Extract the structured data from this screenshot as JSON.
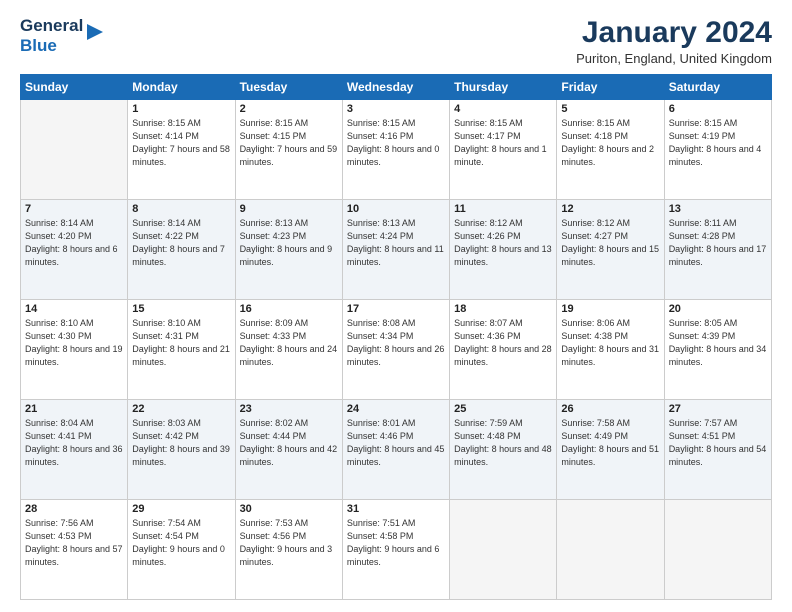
{
  "header": {
    "logo_line1": "General",
    "logo_line2": "Blue",
    "month_title": "January 2024",
    "location": "Puriton, England, United Kingdom"
  },
  "days_of_week": [
    "Sunday",
    "Monday",
    "Tuesday",
    "Wednesday",
    "Thursday",
    "Friday",
    "Saturday"
  ],
  "weeks": [
    [
      {
        "day": "",
        "empty": true
      },
      {
        "day": "1",
        "sunrise": "Sunrise: 8:15 AM",
        "sunset": "Sunset: 4:14 PM",
        "daylight": "Daylight: 7 hours and 58 minutes."
      },
      {
        "day": "2",
        "sunrise": "Sunrise: 8:15 AM",
        "sunset": "Sunset: 4:15 PM",
        "daylight": "Daylight: 7 hours and 59 minutes."
      },
      {
        "day": "3",
        "sunrise": "Sunrise: 8:15 AM",
        "sunset": "Sunset: 4:16 PM",
        "daylight": "Daylight: 8 hours and 0 minutes."
      },
      {
        "day": "4",
        "sunrise": "Sunrise: 8:15 AM",
        "sunset": "Sunset: 4:17 PM",
        "daylight": "Daylight: 8 hours and 1 minute."
      },
      {
        "day": "5",
        "sunrise": "Sunrise: 8:15 AM",
        "sunset": "Sunset: 4:18 PM",
        "daylight": "Daylight: 8 hours and 2 minutes."
      },
      {
        "day": "6",
        "sunrise": "Sunrise: 8:15 AM",
        "sunset": "Sunset: 4:19 PM",
        "daylight": "Daylight: 8 hours and 4 minutes."
      }
    ],
    [
      {
        "day": "7",
        "sunrise": "Sunrise: 8:14 AM",
        "sunset": "Sunset: 4:20 PM",
        "daylight": "Daylight: 8 hours and 6 minutes."
      },
      {
        "day": "8",
        "sunrise": "Sunrise: 8:14 AM",
        "sunset": "Sunset: 4:22 PM",
        "daylight": "Daylight: 8 hours and 7 minutes."
      },
      {
        "day": "9",
        "sunrise": "Sunrise: 8:13 AM",
        "sunset": "Sunset: 4:23 PM",
        "daylight": "Daylight: 8 hours and 9 minutes."
      },
      {
        "day": "10",
        "sunrise": "Sunrise: 8:13 AM",
        "sunset": "Sunset: 4:24 PM",
        "daylight": "Daylight: 8 hours and 11 minutes."
      },
      {
        "day": "11",
        "sunrise": "Sunrise: 8:12 AM",
        "sunset": "Sunset: 4:26 PM",
        "daylight": "Daylight: 8 hours and 13 minutes."
      },
      {
        "day": "12",
        "sunrise": "Sunrise: 8:12 AM",
        "sunset": "Sunset: 4:27 PM",
        "daylight": "Daylight: 8 hours and 15 minutes."
      },
      {
        "day": "13",
        "sunrise": "Sunrise: 8:11 AM",
        "sunset": "Sunset: 4:28 PM",
        "daylight": "Daylight: 8 hours and 17 minutes."
      }
    ],
    [
      {
        "day": "14",
        "sunrise": "Sunrise: 8:10 AM",
        "sunset": "Sunset: 4:30 PM",
        "daylight": "Daylight: 8 hours and 19 minutes."
      },
      {
        "day": "15",
        "sunrise": "Sunrise: 8:10 AM",
        "sunset": "Sunset: 4:31 PM",
        "daylight": "Daylight: 8 hours and 21 minutes."
      },
      {
        "day": "16",
        "sunrise": "Sunrise: 8:09 AM",
        "sunset": "Sunset: 4:33 PM",
        "daylight": "Daylight: 8 hours and 24 minutes."
      },
      {
        "day": "17",
        "sunrise": "Sunrise: 8:08 AM",
        "sunset": "Sunset: 4:34 PM",
        "daylight": "Daylight: 8 hours and 26 minutes."
      },
      {
        "day": "18",
        "sunrise": "Sunrise: 8:07 AM",
        "sunset": "Sunset: 4:36 PM",
        "daylight": "Daylight: 8 hours and 28 minutes."
      },
      {
        "day": "19",
        "sunrise": "Sunrise: 8:06 AM",
        "sunset": "Sunset: 4:38 PM",
        "daylight": "Daylight: 8 hours and 31 minutes."
      },
      {
        "day": "20",
        "sunrise": "Sunrise: 8:05 AM",
        "sunset": "Sunset: 4:39 PM",
        "daylight": "Daylight: 8 hours and 34 minutes."
      }
    ],
    [
      {
        "day": "21",
        "sunrise": "Sunrise: 8:04 AM",
        "sunset": "Sunset: 4:41 PM",
        "daylight": "Daylight: 8 hours and 36 minutes."
      },
      {
        "day": "22",
        "sunrise": "Sunrise: 8:03 AM",
        "sunset": "Sunset: 4:42 PM",
        "daylight": "Daylight: 8 hours and 39 minutes."
      },
      {
        "day": "23",
        "sunrise": "Sunrise: 8:02 AM",
        "sunset": "Sunset: 4:44 PM",
        "daylight": "Daylight: 8 hours and 42 minutes."
      },
      {
        "day": "24",
        "sunrise": "Sunrise: 8:01 AM",
        "sunset": "Sunset: 4:46 PM",
        "daylight": "Daylight: 8 hours and 45 minutes."
      },
      {
        "day": "25",
        "sunrise": "Sunrise: 7:59 AM",
        "sunset": "Sunset: 4:48 PM",
        "daylight": "Daylight: 8 hours and 48 minutes."
      },
      {
        "day": "26",
        "sunrise": "Sunrise: 7:58 AM",
        "sunset": "Sunset: 4:49 PM",
        "daylight": "Daylight: 8 hours and 51 minutes."
      },
      {
        "day": "27",
        "sunrise": "Sunrise: 7:57 AM",
        "sunset": "Sunset: 4:51 PM",
        "daylight": "Daylight: 8 hours and 54 minutes."
      }
    ],
    [
      {
        "day": "28",
        "sunrise": "Sunrise: 7:56 AM",
        "sunset": "Sunset: 4:53 PM",
        "daylight": "Daylight: 8 hours and 57 minutes."
      },
      {
        "day": "29",
        "sunrise": "Sunrise: 7:54 AM",
        "sunset": "Sunset: 4:54 PM",
        "daylight": "Daylight: 9 hours and 0 minutes."
      },
      {
        "day": "30",
        "sunrise": "Sunrise: 7:53 AM",
        "sunset": "Sunset: 4:56 PM",
        "daylight": "Daylight: 9 hours and 3 minutes."
      },
      {
        "day": "31",
        "sunrise": "Sunrise: 7:51 AM",
        "sunset": "Sunset: 4:58 PM",
        "daylight": "Daylight: 9 hours and 6 minutes."
      },
      {
        "day": "",
        "empty": true
      },
      {
        "day": "",
        "empty": true
      },
      {
        "day": "",
        "empty": true
      }
    ]
  ]
}
